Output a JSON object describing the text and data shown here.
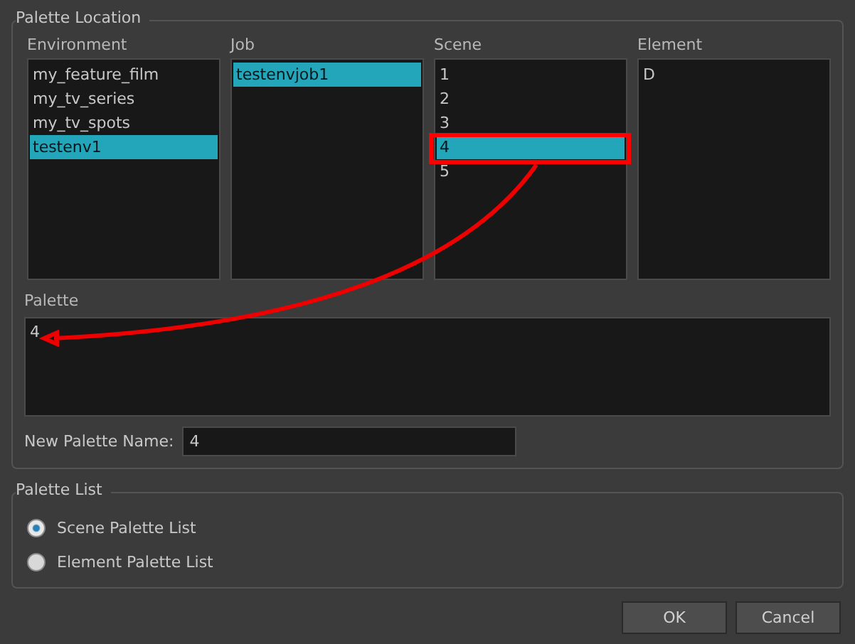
{
  "palette_location": {
    "title": "Palette Location",
    "lists": [
      {
        "label": "Environment",
        "items": [
          {
            "text": "my_feature_film",
            "selected": false
          },
          {
            "text": "my_tv_series",
            "selected": false
          },
          {
            "text": "my_tv_spots",
            "selected": false
          },
          {
            "text": "testenv1",
            "selected": true
          }
        ]
      },
      {
        "label": "Job",
        "items": [
          {
            "text": "testenvjob1",
            "selected": true
          }
        ]
      },
      {
        "label": "Scene",
        "items": [
          {
            "text": "1",
            "selected": false
          },
          {
            "text": "2",
            "selected": false
          },
          {
            "text": "3",
            "selected": false
          },
          {
            "text": "4",
            "selected": true
          },
          {
            "text": "5",
            "selected": false
          }
        ]
      },
      {
        "label": "Element",
        "items": [
          {
            "text": "D",
            "selected": false
          }
        ]
      }
    ],
    "palette": {
      "label": "Palette",
      "items": [
        "4"
      ]
    },
    "new_palette_name": {
      "label": "New Palette Name:",
      "value": "4"
    }
  },
  "palette_list": {
    "title": "Palette List",
    "options": [
      {
        "label": "Scene Palette List",
        "selected": true
      },
      {
        "label": "Element Palette List",
        "selected": false
      }
    ]
  },
  "buttons": [
    "OK",
    "Cancel"
  ]
}
